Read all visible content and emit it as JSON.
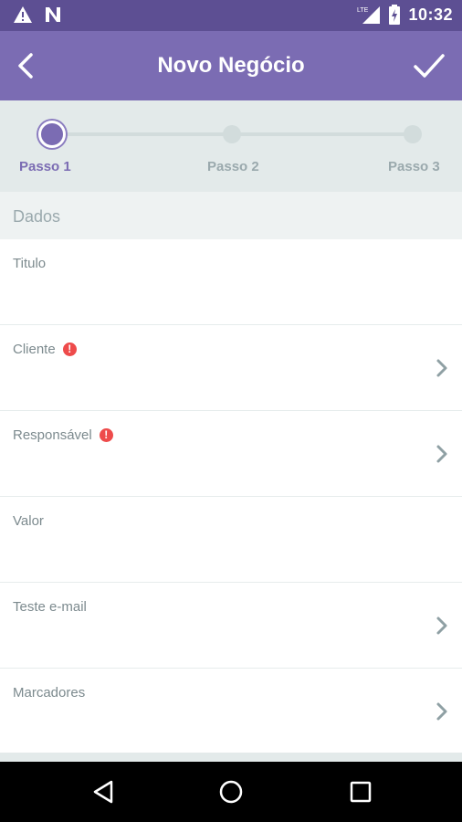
{
  "status_bar": {
    "time": "10:32",
    "icons": [
      "warning-icon",
      "n-notification-icon",
      "lte-signal-icon",
      "battery-charging-icon"
    ]
  },
  "app_bar": {
    "title": "Novo Negócio",
    "back_icon": "arrow-left-icon",
    "confirm_icon": "check-icon"
  },
  "stepper": {
    "current": 1,
    "steps": [
      {
        "label": "Passo 1"
      },
      {
        "label": "Passo 2"
      },
      {
        "label": "Passo 3"
      }
    ]
  },
  "section": {
    "title": "Dados"
  },
  "fields": [
    {
      "label": "Titulo",
      "required_alert": false,
      "chevron": false
    },
    {
      "label": "Cliente",
      "required_alert": true,
      "chevron": true
    },
    {
      "label": "Responsável",
      "required_alert": true,
      "chevron": true
    },
    {
      "label": "Valor",
      "required_alert": false,
      "chevron": false
    },
    {
      "label": "Teste e-mail",
      "required_alert": false,
      "chevron": true
    },
    {
      "label": "Marcadores",
      "required_alert": false,
      "chevron": true
    }
  ],
  "alert_glyph": "!",
  "colors": {
    "app_bar": "#7b6cb3",
    "status_bar": "#5d4f93",
    "active_step": "#7b6cb3",
    "inactive_step": "#9aa9ad",
    "alert": "#ee4b4b",
    "chevron": "#8fa0a4"
  },
  "nav_bar": {
    "icons": [
      "triangle-back-icon",
      "circle-home-icon",
      "square-recents-icon"
    ]
  }
}
